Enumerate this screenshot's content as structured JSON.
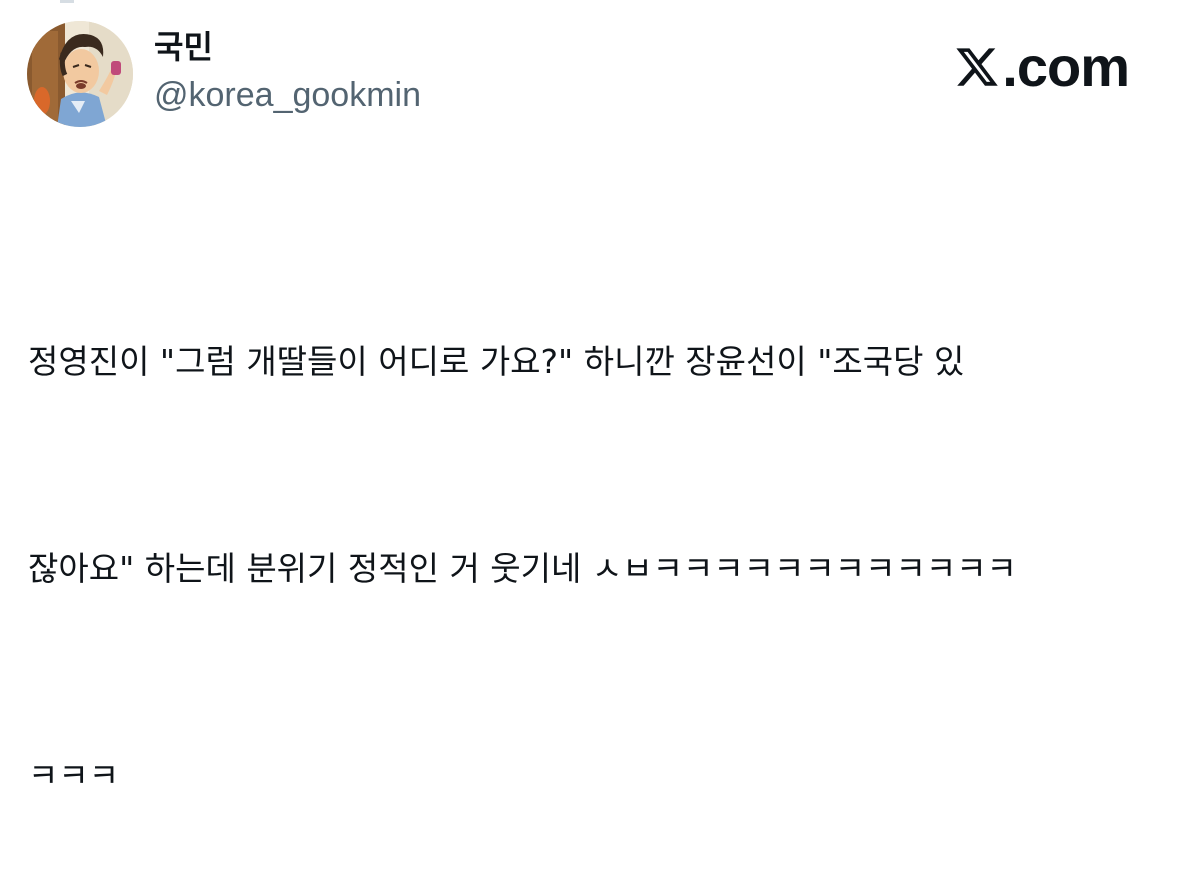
{
  "author": {
    "display_name": "국민",
    "handle": "@korea_gookmin",
    "avatar_icon": "cartoon-man-avatar"
  },
  "brand": {
    "label": ".com",
    "logo_icon": "x-logo-icon"
  },
  "tweet": {
    "lines": [
      "정영진이 \"그럼 개딸들이 어디로 가요?\" 하니깐 장윤선이 \"조국당 있",
      "잖아요\" 하는데 분위기 정적인 거 웃기네 ㅅㅂㅋㅋㅋㅋㅋㅋㅋㅋㅋㅋㅋㅋ",
      "ㅋㅋㅋ"
    ]
  },
  "colors": {
    "text_primary": "#0f1419",
    "text_secondary": "#536471",
    "background": "#ffffff"
  }
}
